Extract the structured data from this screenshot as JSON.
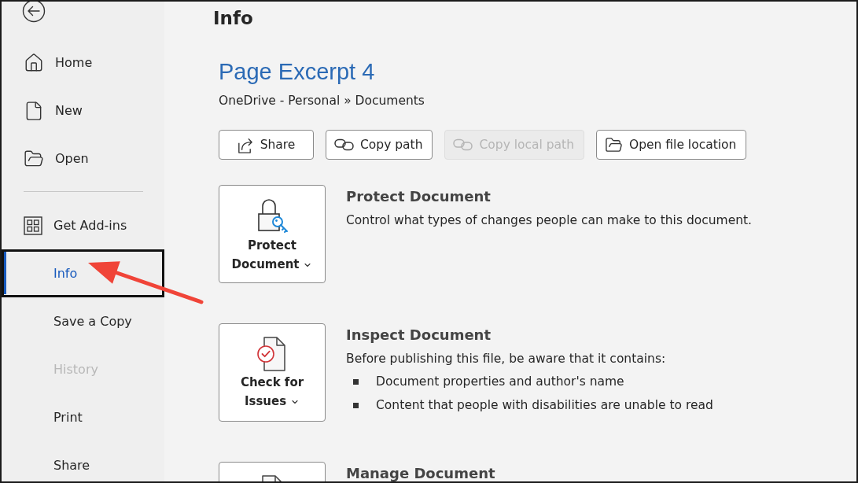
{
  "sidebar": {
    "groups": [
      {
        "items": [
          {
            "label": "Home",
            "selected": false,
            "disabled": false,
            "highlighted": false
          },
          {
            "label": "New",
            "selected": false,
            "disabled": false,
            "highlighted": false
          },
          {
            "label": "Open",
            "selected": false,
            "disabled": false,
            "highlighted": false
          }
        ]
      },
      {
        "items": [
          {
            "label": "Get Add-ins",
            "selected": false,
            "disabled": false,
            "highlighted": false
          },
          {
            "label": "Info",
            "selected": true,
            "disabled": false,
            "highlighted": true
          },
          {
            "label": "Save a Copy",
            "selected": false,
            "disabled": false,
            "highlighted": false
          },
          {
            "label": "History",
            "selected": false,
            "disabled": true,
            "highlighted": false
          },
          {
            "label": "Print",
            "selected": false,
            "disabled": false,
            "highlighted": false
          },
          {
            "label": "Share",
            "selected": false,
            "disabled": false,
            "highlighted": false
          }
        ]
      }
    ]
  },
  "page_title": "Info",
  "document": {
    "title": "Page Excerpt 4",
    "location": "OneDrive - Personal » Documents"
  },
  "actions": [
    {
      "label": "Share",
      "disabled": false
    },
    {
      "label": "Copy path",
      "disabled": false
    },
    {
      "label": "Copy local path",
      "disabled": true
    },
    {
      "label": "Open file location",
      "disabled": false
    }
  ],
  "sections": [
    {
      "tile_label": "Protect Document",
      "title": "Protect Document",
      "description": "Control what types of changes people can make to this document."
    },
    {
      "tile_label": "Check for Issues",
      "title": "Inspect Document",
      "description": "Before publishing this file, be aware that it contains:",
      "bullets": [
        "Document properties and author's name",
        "Content that people with disabilities are unable to read"
      ]
    },
    {
      "title": "Manage Document"
    }
  ]
}
